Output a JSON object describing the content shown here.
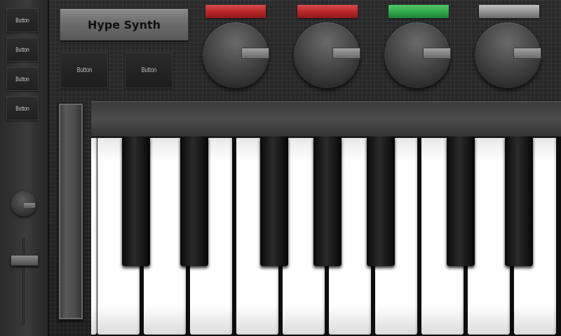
{
  "app": {
    "title": "Hype Synth"
  },
  "side_panel": {
    "buttons": [
      {
        "label": "Button"
      },
      {
        "label": "Button"
      },
      {
        "label": "Button"
      },
      {
        "label": "Button"
      }
    ]
  },
  "top_controls": {
    "buttons": [
      {
        "label": "Button"
      },
      {
        "label": "Button"
      }
    ],
    "indicators": [
      {
        "color": "#c43a3a"
      },
      {
        "color": "#c43a3a"
      },
      {
        "color": "#3fb85a"
      },
      {
        "color": "#a6a6a6"
      }
    ]
  },
  "keyboard": {
    "white_keys": 11,
    "black_keys": 7
  }
}
